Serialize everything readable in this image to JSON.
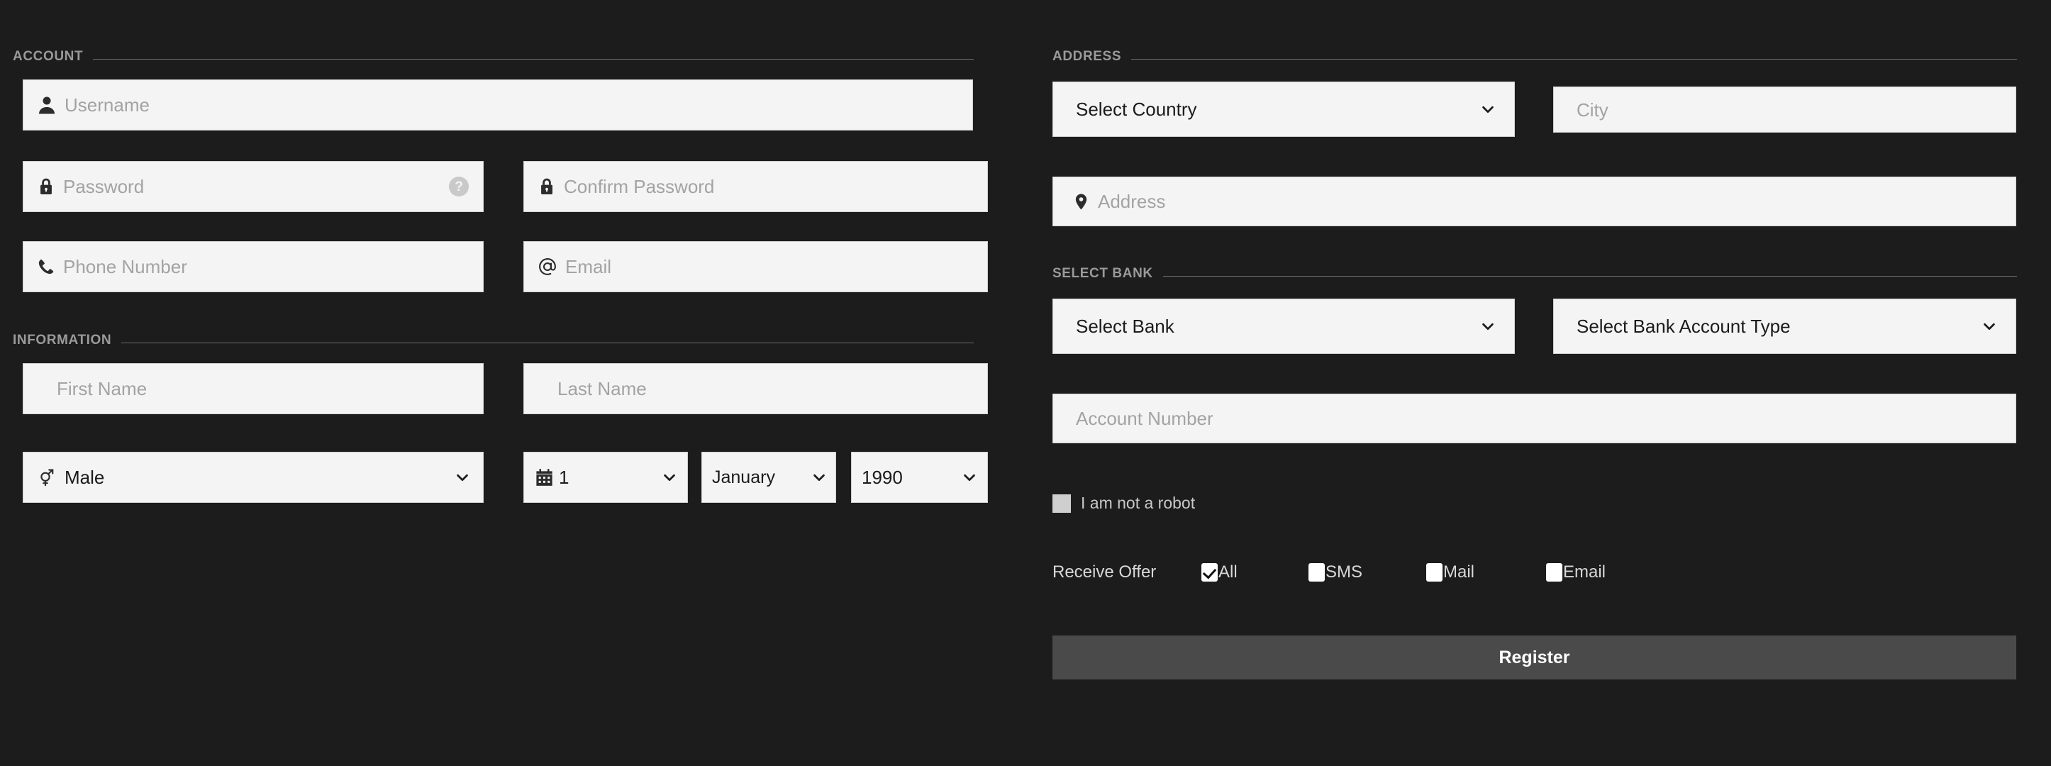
{
  "sections": {
    "account": {
      "title": "ACCOUNT"
    },
    "information": {
      "title": "INFORMATION"
    },
    "address": {
      "title": "ADDRESS"
    },
    "select_bank": {
      "title": "SELECT BANK"
    }
  },
  "account": {
    "username": {
      "placeholder": "Username",
      "value": "",
      "icon": "user-icon"
    },
    "password": {
      "placeholder": "Password",
      "value": "",
      "icon": "lock-icon",
      "help": "?"
    },
    "confirm_password": {
      "placeholder": "Confirm Password",
      "value": "",
      "icon": "lock-icon"
    },
    "phone": {
      "placeholder": "Phone Number",
      "value": "",
      "icon": "phone-icon"
    },
    "email": {
      "placeholder": "Email",
      "value": "",
      "icon": "at-icon"
    }
  },
  "information": {
    "first_name": {
      "placeholder": "First Name",
      "value": ""
    },
    "last_name": {
      "placeholder": "Last Name",
      "value": ""
    },
    "gender": {
      "selected": "Male",
      "icon": "gender-icon"
    },
    "birth_day": {
      "selected": "1",
      "icon": "calendar-icon"
    },
    "birth_month": {
      "selected": "January"
    },
    "birth_year": {
      "selected": "1990"
    }
  },
  "address": {
    "country": {
      "selected": "Select Country"
    },
    "city": {
      "placeholder": "City",
      "value": ""
    },
    "street": {
      "placeholder": "Address",
      "value": "",
      "icon": "map-pin-icon"
    }
  },
  "bank": {
    "bank_name": {
      "selected": "Select Bank"
    },
    "account_type": {
      "selected": "Select Bank Account Type"
    },
    "account_number": {
      "placeholder": "Account Number",
      "value": ""
    }
  },
  "captcha": {
    "label": "I am not a robot",
    "checked": false
  },
  "receive_offer": {
    "caption": "Receive Offer",
    "options": [
      {
        "label": "All",
        "checked": true
      },
      {
        "label": "SMS",
        "checked": false
      },
      {
        "label": "Mail",
        "checked": false
      },
      {
        "label": "Email",
        "checked": false
      }
    ]
  },
  "actions": {
    "register_label": "Register"
  },
  "colors": {
    "background": "#1c1c1c",
    "field_background": "#f4f4f4",
    "placeholder": "#a3a3a3",
    "section_label": "#9a9a9a",
    "button_background": "#4a4a4a"
  }
}
